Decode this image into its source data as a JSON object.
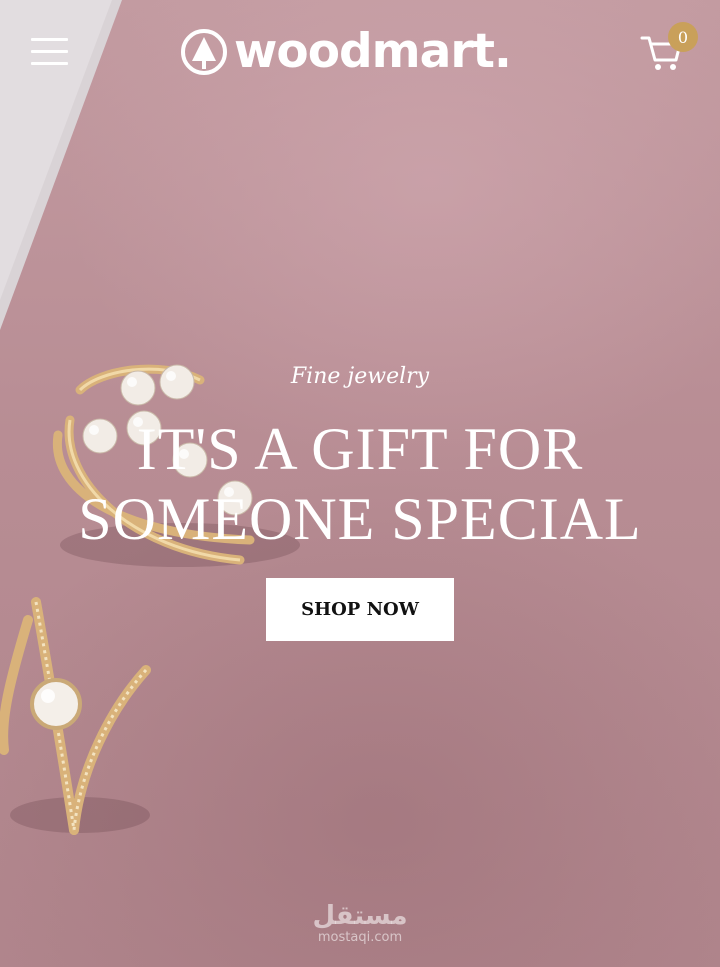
{
  "header": {
    "brand": "woodmart.",
    "cart_count": "0"
  },
  "hero": {
    "subtitle": "Fine jewelry",
    "headline_line1": "IT'S A GIFT FOR",
    "headline_line2": "SOMEONE SPECIAL",
    "cta_label": "SHOP NOW"
  },
  "watermark": {
    "arabic": "مستقل",
    "latin": "mostaqi.com"
  },
  "colors": {
    "background": "#b68a91",
    "accent_badge": "#c9a05a",
    "text": "#ffffff",
    "button_bg": "#ffffff",
    "button_text": "#111111"
  },
  "icons": {
    "menu": "hamburger-menu-icon",
    "logo": "tree-logo-icon",
    "cart": "shopping-cart-icon"
  }
}
